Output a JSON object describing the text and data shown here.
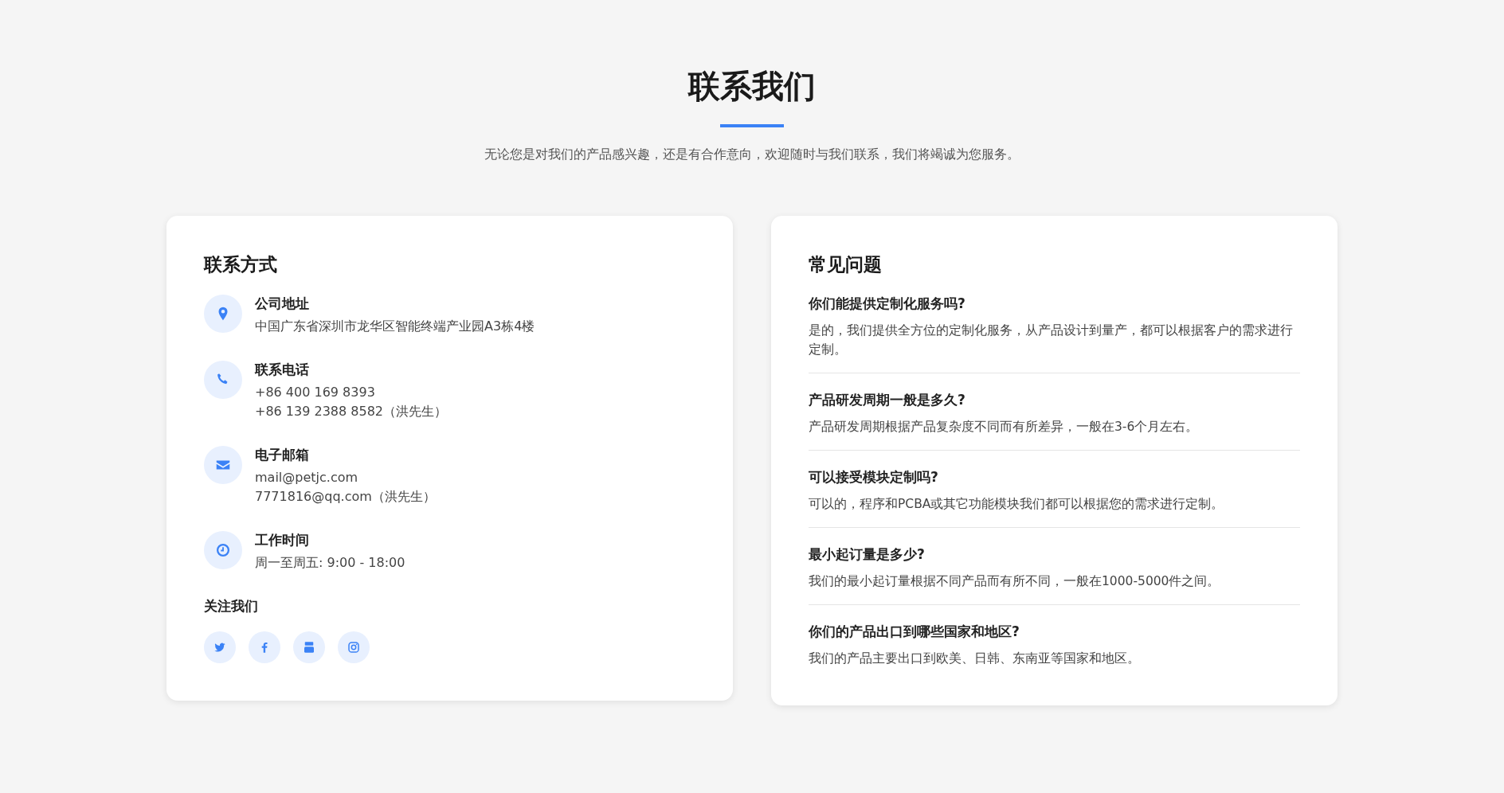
{
  "header": {
    "title": "联系我们",
    "subtitle": "无论您是对我们的产品感兴趣，还是有合作意向，欢迎随时与我们联系，我们将竭诚为您服务。"
  },
  "contact": {
    "heading": "联系方式",
    "items": [
      {
        "kind": "location",
        "title": "公司地址",
        "lines": [
          "中国广东省深圳市龙华区智能终端产业园A3栋4楼"
        ]
      },
      {
        "kind": "phone",
        "title": "联系电话",
        "lines": [
          "+86 400 169 8393",
          "+86 139 2388 8582（洪先生）"
        ]
      },
      {
        "kind": "envelope",
        "title": "电子邮箱",
        "lines": [
          "mail@petjc.com",
          "7771816@qq.com（洪先生）"
        ]
      },
      {
        "kind": "clock",
        "title": "工作时间",
        "lines": [
          "周一至周五: 9:00 - 18:00"
        ]
      }
    ],
    "follow_heading": "关注我们",
    "social": [
      {
        "kind": "twitter"
      },
      {
        "kind": "facebook"
      },
      {
        "kind": "youtube"
      },
      {
        "kind": "instagram"
      }
    ]
  },
  "faq": {
    "heading": "常见问题",
    "items": [
      {
        "question": "你们能提供定制化服务吗?",
        "answer": "是的，我们提供全方位的定制化服务，从产品设计到量产，都可以根据客户的需求进行定制。"
      },
      {
        "question": "产品研发周期一般是多久?",
        "answer": "产品研发周期根据产品复杂度不同而有所差异，一般在3-6个月左右。"
      },
      {
        "question": "可以接受模块定制吗?",
        "answer": "可以的，程序和PCBA或其它功能模块我们都可以根据您的需求进行定制。"
      },
      {
        "question": "最小起订量是多少?",
        "answer": "我们的最小起订量根据不同产品而有所不同，一般在1000-5000件之间。"
      },
      {
        "question": "你们的产品出口到哪些国家和地区?",
        "answer": "我们的产品主要出口到欧美、日韩、东南亚等国家和地区。"
      }
    ]
  }
}
